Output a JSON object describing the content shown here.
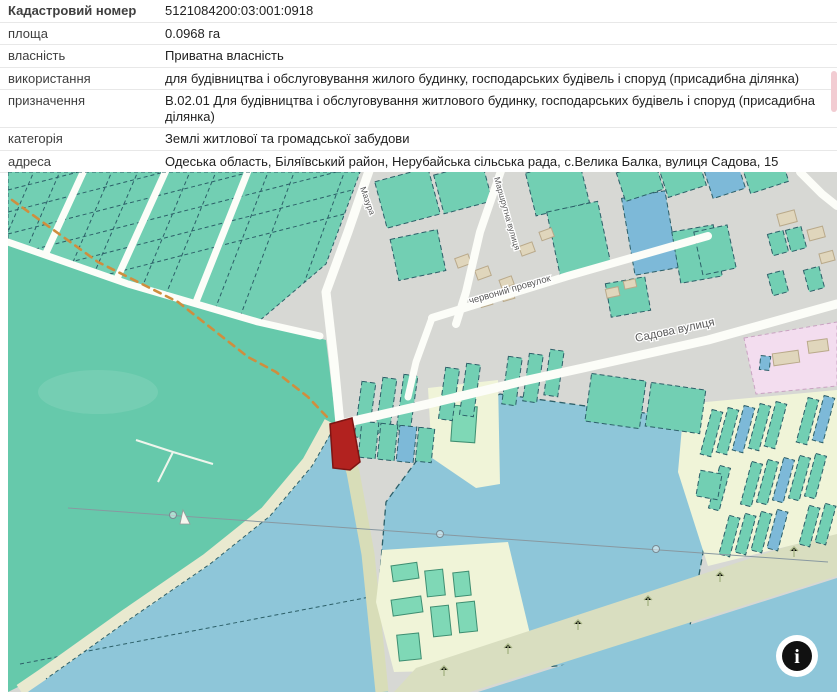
{
  "info_table": {
    "rows": [
      {
        "label": "Кадастровий номер",
        "value": "5121084200:03:001:0918"
      },
      {
        "label": "площа",
        "value": "0.0968 га"
      },
      {
        "label": "власність",
        "value": "Приватна власність"
      },
      {
        "label": "використання",
        "value": "для будівництва і обслуговування жилого будинку, господарських будівель і споруд (присадибна ділянка)"
      },
      {
        "label": "призначення",
        "value": "В.02.01 Для будівництва і обслуговування житлового будинку, господарських будівель і споруд (присадибна ділянка)"
      },
      {
        "label": "категорія",
        "value": "Землі житлової та громадської забудови"
      },
      {
        "label": "адреса",
        "value": "Одеська область, Біляївський район, Нерубайська сільська рада, с.Велика Балка, вулиця Садова, 15"
      }
    ]
  },
  "map": {
    "street_labels": [
      {
        "id": "mazura",
        "text": "Мазура"
      },
      {
        "id": "marshrutna",
        "text": "Маршрутна вулиця"
      },
      {
        "id": "chervonyi",
        "text": "червоний провулок"
      },
      {
        "id": "sadova",
        "text": "Садова вулиця"
      }
    ],
    "selected_parcel": {
      "cadastral_number": "5121084200:03:001:0918",
      "color": "#b2221f"
    },
    "info_button_icon": "i"
  },
  "colors": {
    "map_bg": "#d7d8d4",
    "teal_parcel": "#72cfb3",
    "blue_parcel": "#7db9d8",
    "water": "#8ec6d9",
    "selected_parcel": "#b2221f",
    "pink_zone": "#f3ddef",
    "scroll_thumb": "#f2ccd2"
  }
}
